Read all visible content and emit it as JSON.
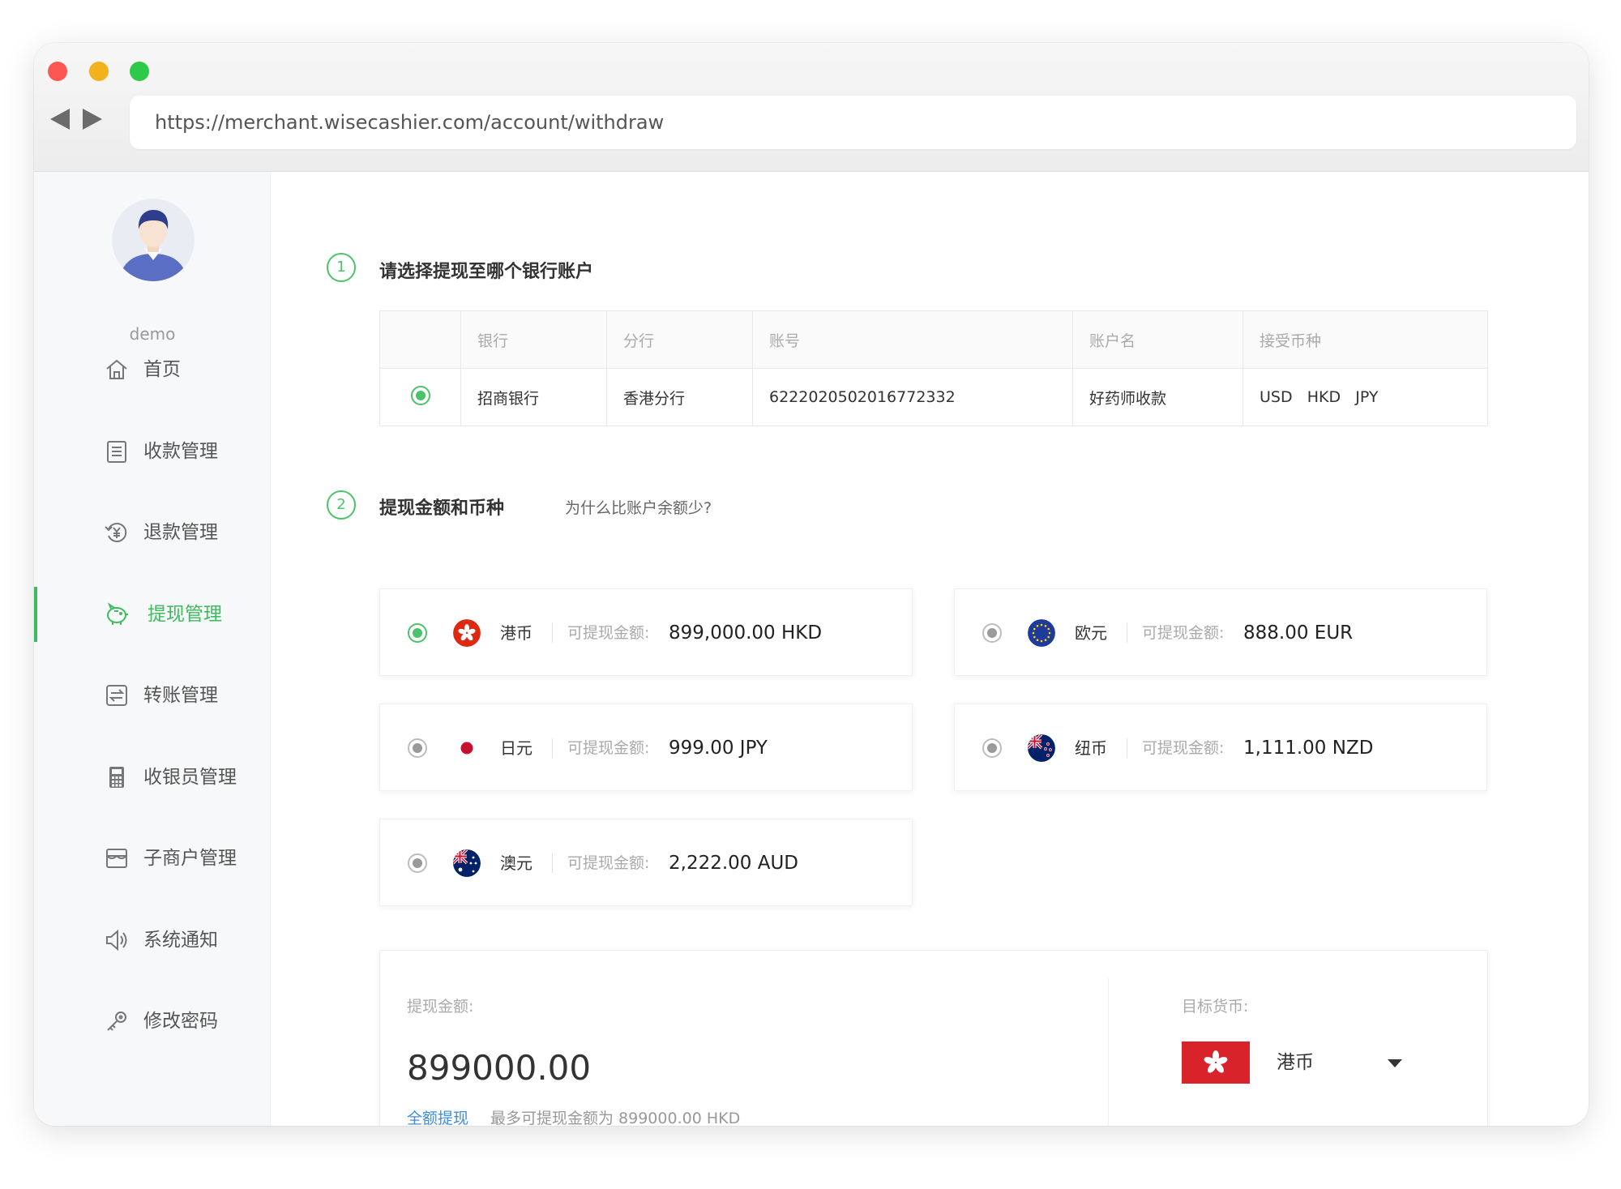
{
  "browser": {
    "url": "https://merchant.wisecashier.com/account/withdraw"
  },
  "sidebar": {
    "username": "demo",
    "items": [
      {
        "label": "首页",
        "icon": "home-icon"
      },
      {
        "label": "收款管理",
        "icon": "list-icon"
      },
      {
        "label": "退款管理",
        "icon": "refund-icon"
      },
      {
        "label": "提现管理",
        "icon": "piggy-bank-icon",
        "active": true
      },
      {
        "label": "转账管理",
        "icon": "transfer-icon"
      },
      {
        "label": "收银员管理",
        "icon": "calculator-icon"
      },
      {
        "label": "子商户管理",
        "icon": "store-icon"
      },
      {
        "label": "系统通知",
        "icon": "speaker-icon"
      },
      {
        "label": "修改密码",
        "icon": "key-icon"
      }
    ]
  },
  "step1": {
    "number": "1",
    "title": "请选择提现至哪个银行账户",
    "columns": [
      "银行",
      "分行",
      "账号",
      "账户名",
      "接受币种"
    ],
    "rows": [
      {
        "bank": "招商银行",
        "branch": "香港分行",
        "account": "6222020502016772332",
        "name": "好药师收款",
        "currencies": "USD   HKD   JPY",
        "selected": true
      }
    ]
  },
  "step2": {
    "number": "2",
    "title": "提现金额和币种",
    "hint": "为什么比账户余额少?",
    "available_label": "可提现金额:",
    "currencies": [
      {
        "name": "港币",
        "amount": "899,000.00 HKD",
        "flag": "hk-flag-icon",
        "selected": true
      },
      {
        "name": "欧元",
        "amount": "888.00 EUR",
        "flag": "eu-flag-icon",
        "selected": false
      },
      {
        "name": "日元",
        "amount": "999.00 JPY",
        "flag": "jp-flag-icon",
        "selected": false
      },
      {
        "name": "纽币",
        "amount": "1,111.00 NZD",
        "flag": "nz-flag-icon",
        "selected": false
      },
      {
        "name": "澳元",
        "amount": "2,222.00 AUD",
        "flag": "au-flag-icon",
        "selected": false
      }
    ]
  },
  "withdraw": {
    "amount_label": "提现金额:",
    "amount": "899000.00",
    "full_link": "全额提现",
    "max_note": "最多可提现金额为 899000.00 HKD",
    "target_label": "目标货币:",
    "target_currency": "港币"
  },
  "colors": {
    "accent": "#3dbb5d",
    "link": "#3d8de3",
    "hk_red": "#d8232a"
  }
}
